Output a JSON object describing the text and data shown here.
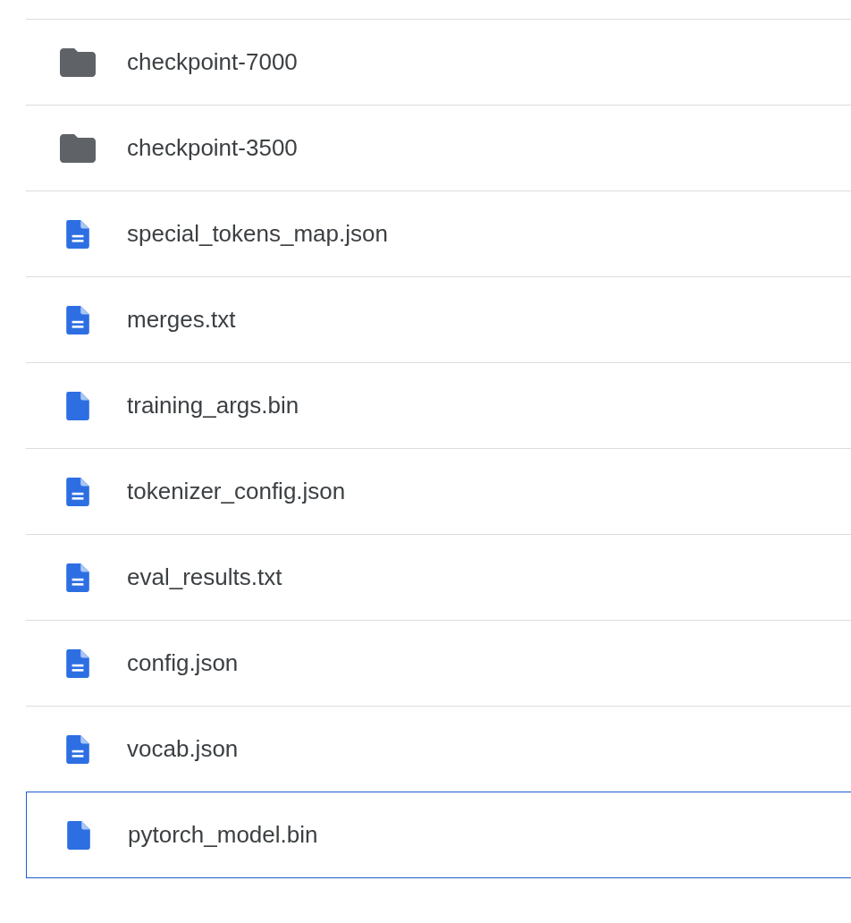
{
  "items": [
    {
      "kind": "folder",
      "name": "checkpoint-7000",
      "selected": false
    },
    {
      "kind": "folder",
      "name": "checkpoint-3500",
      "selected": false
    },
    {
      "kind": "document",
      "name": "special_tokens_map.json",
      "selected": false
    },
    {
      "kind": "document",
      "name": "merges.txt",
      "selected": false
    },
    {
      "kind": "file",
      "name": "training_args.bin",
      "selected": false
    },
    {
      "kind": "document",
      "name": "tokenizer_config.json",
      "selected": false
    },
    {
      "kind": "document",
      "name": "eval_results.txt",
      "selected": false
    },
    {
      "kind": "document",
      "name": "config.json",
      "selected": false
    },
    {
      "kind": "document",
      "name": "vocab.json",
      "selected": false
    },
    {
      "kind": "file",
      "name": "pytorch_model.bin",
      "selected": true
    }
  ]
}
